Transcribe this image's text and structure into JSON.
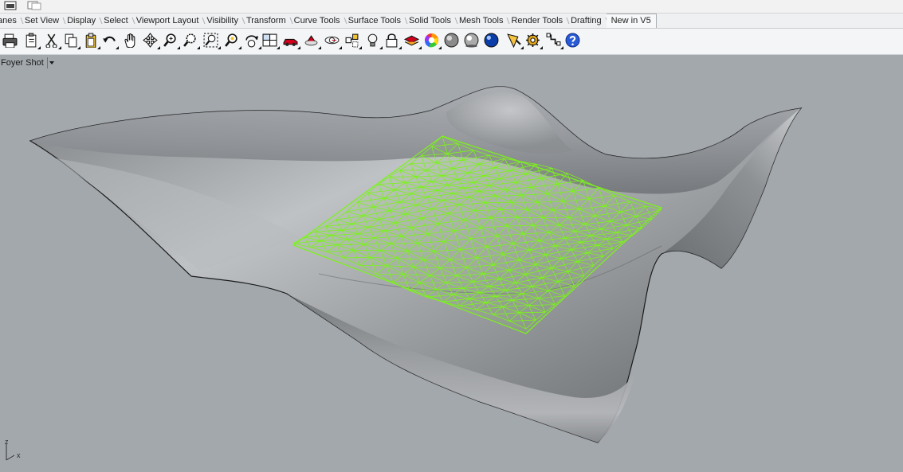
{
  "tabs": [
    {
      "label": "anes"
    },
    {
      "label": "Set View"
    },
    {
      "label": "Display"
    },
    {
      "label": "Select"
    },
    {
      "label": "Viewport Layout"
    },
    {
      "label": "Visibility"
    },
    {
      "label": "Transform"
    },
    {
      "label": "Curve Tools"
    },
    {
      "label": "Surface Tools"
    },
    {
      "label": "Solid Tools"
    },
    {
      "label": "Mesh Tools"
    },
    {
      "label": "Render Tools"
    },
    {
      "label": "Drafting"
    },
    {
      "label": "New in V5"
    }
  ],
  "toolbar_icons": [
    "print-icon",
    "paste-icon",
    "cut-icon",
    "copy-icon",
    "clipboard-icon",
    "undo-icon",
    "pan-hand-icon",
    "move-icon",
    "zoom-icon",
    "zoom-window-icon",
    "zoom-extents-icon",
    "zoom-selected-icon",
    "rotate-view-icon",
    "four-viewports-icon",
    "car-icon",
    "display-mode-icon",
    "orbit-icon",
    "select-filter-icon",
    "lightbulb-icon",
    "lock-icon",
    "layer-icon",
    "color-wheel-icon",
    "shade-sphere-icon",
    "rendered-sphere-icon",
    "render-sphere-icon",
    "material-icon",
    "options-gear-icon",
    "grasshopper-icon",
    "help-icon"
  ],
  "viewport": {
    "title": "Foyer Shot",
    "axis_z": "z",
    "axis_x": "x"
  },
  "colors": {
    "viewport_bg": "#a3a8ad",
    "surface": "#8c8f92",
    "mesh": "#7cf21c"
  }
}
